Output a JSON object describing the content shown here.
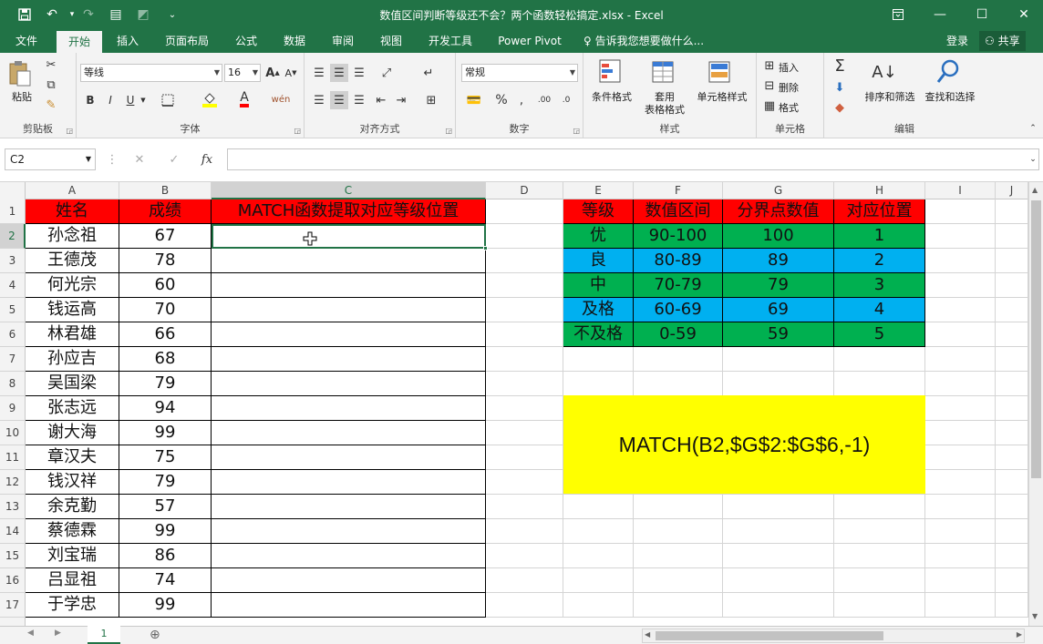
{
  "window": {
    "title": "数值区间判断等级还不会？两个函数轻松搞定.xlsx - Excel"
  },
  "tabs": [
    "文件",
    "开始",
    "插入",
    "页面布局",
    "公式",
    "数据",
    "审阅",
    "视图",
    "开发工具",
    "Power Pivot"
  ],
  "tellme": "告诉我您想要做什么...",
  "signin": "登录",
  "share": "共享",
  "ribbon": {
    "clipboard": {
      "label": "剪贴板",
      "paste": "粘贴"
    },
    "font": {
      "label": "字体",
      "name": "等线",
      "size": "16",
      "bold": "B",
      "italic": "I",
      "underline": "U"
    },
    "align": {
      "label": "对齐方式"
    },
    "number": {
      "label": "数字",
      "format": "常规",
      "percent": "%"
    },
    "styles": {
      "label": "样式",
      "cond": "条件格式",
      "table1": "套用",
      "table2": "表格格式",
      "cell": "单元格样式"
    },
    "cells": {
      "label": "单元格",
      "insert": "插入",
      "delete": "删除",
      "format": "格式"
    },
    "edit": {
      "label": "编辑",
      "sort": "排序和筛选",
      "find": "查找和选择"
    }
  },
  "formula_bar": {
    "name_box": "C2",
    "fx": "fx",
    "value": ""
  },
  "columns": [
    "A",
    "B",
    "C",
    "D",
    "E",
    "F",
    "G",
    "H",
    "I",
    "J"
  ],
  "rows": [
    "1",
    "2",
    "3",
    "4",
    "5",
    "6",
    "7",
    "8",
    "9",
    "10",
    "11",
    "12",
    "13",
    "14",
    "15",
    "16",
    "17"
  ],
  "selected_cell": "C2",
  "header_row": [
    "姓名",
    "成绩",
    "MATCH函数提取对应等级位置"
  ],
  "students": [
    [
      "孙念祖",
      "67"
    ],
    [
      "王德茂",
      "78"
    ],
    [
      "何光宗",
      "60"
    ],
    [
      "钱运高",
      "70"
    ],
    [
      "林君雄",
      "66"
    ],
    [
      "孙应吉",
      "68"
    ],
    [
      "吴国梁",
      "79"
    ],
    [
      "张志远",
      "94"
    ],
    [
      "谢大海",
      "99"
    ],
    [
      "章汉夫",
      "75"
    ],
    [
      "钱汉祥",
      "79"
    ],
    [
      "余克勤",
      "57"
    ],
    [
      "蔡德霖",
      "99"
    ],
    [
      "刘宝瑞",
      "86"
    ],
    [
      "吕显祖",
      "74"
    ],
    [
      "于学忠",
      "99"
    ]
  ],
  "lookup_header": [
    "等级",
    "数值区间",
    "分界点数值",
    "对应位置"
  ],
  "lookup_rows": [
    [
      "优",
      "90-100",
      "100",
      "1"
    ],
    [
      "良",
      "80-89",
      "89",
      "2"
    ],
    [
      "中",
      "70-79",
      "79",
      "3"
    ],
    [
      "及格",
      "60-69",
      "69",
      "4"
    ],
    [
      "不及格",
      "0-59",
      "59",
      "5"
    ]
  ],
  "formula_note": "MATCH(B2,$G$2:$G$6,-1)",
  "sheet_tab": "1",
  "colors": {
    "red": "#ff0000",
    "green": "#00b050",
    "blue": "#00b0f0",
    "yellow": "#ffff00",
    "excel": "#217346"
  }
}
